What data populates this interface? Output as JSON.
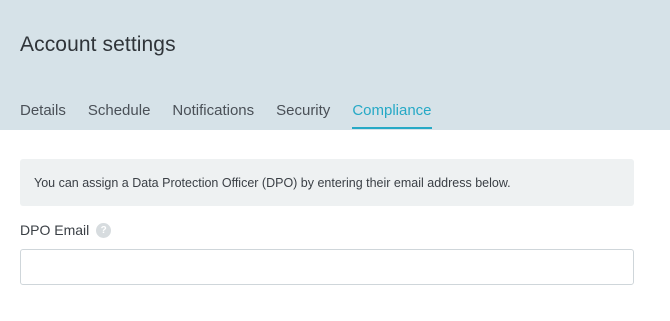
{
  "header": {
    "title": "Account settings",
    "tabs": [
      {
        "label": "Details",
        "active": false
      },
      {
        "label": "Schedule",
        "active": false
      },
      {
        "label": "Notifications",
        "active": false
      },
      {
        "label": "Security",
        "active": false
      },
      {
        "label": "Compliance",
        "active": true
      }
    ]
  },
  "main": {
    "info_text": "You can assign a Data Protection Officer (DPO) by entering their email address below.",
    "dpo_email": {
      "label": "DPO Email",
      "help_icon": "question-mark-icon",
      "value": "",
      "placeholder": ""
    }
  },
  "colors": {
    "header_bg": "#d6e2e8",
    "accent": "#26a9c6",
    "info_bg": "#eef1f2"
  }
}
